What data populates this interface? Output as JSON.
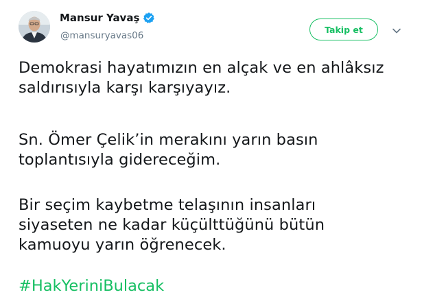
{
  "author": {
    "display_name": "Mansur Yavaş",
    "handle": "@mansuryavas06",
    "verified": true,
    "avatar_icon": "user-avatar-photo",
    "verified_icon": "verified-badge-icon"
  },
  "actions": {
    "follow_label": "Takip et",
    "more_icon": "chevron-down-icon"
  },
  "tweet": {
    "paragraphs": [
      {
        "lines": [
          "Demokrasi hayatımızın en alçak ve en ahlâksız",
          "saldırısıyla karşı karşıyayız."
        ]
      },
      {
        "lines": [
          "Sn. Ömer Çelik’in merakını yarın basın",
          "toplantısıyla gidereceğim."
        ]
      },
      {
        "lines": [
          "Bir seçim kaybetme telaşının insanları",
          "siyaseten ne kadar küçülttüğünü bütün",
          "kamuoyu yarın öğrenecek."
        ]
      }
    ],
    "hashtag": "#HakYeriniBulacak"
  },
  "colors": {
    "accent_green": "#17bf63",
    "verified_blue": "#1da1f2",
    "secondary_text": "#657786",
    "primary_text": "#14171a"
  }
}
